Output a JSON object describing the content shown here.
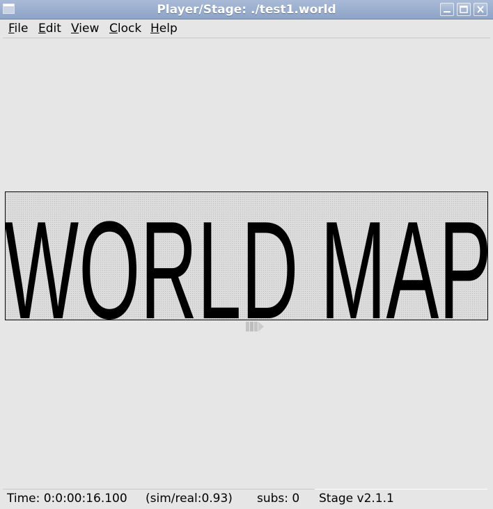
{
  "window": {
    "title": "Player/Stage: ./test1.world"
  },
  "menu": {
    "items": [
      {
        "mnemonic": "F",
        "rest": "ile"
      },
      {
        "mnemonic": "E",
        "rest": "dit"
      },
      {
        "mnemonic": "V",
        "rest": "iew"
      },
      {
        "mnemonic": "C",
        "rest": "lock"
      },
      {
        "mnemonic": "H",
        "rest": "elp"
      }
    ]
  },
  "map": {
    "text": "WORLD MAP",
    "background": "#dcdcdc",
    "ink": "#000000"
  },
  "status": {
    "time": "Time: 0:0:00:16.100",
    "ratio": "(sim/real:0.93)",
    "subs": "subs: 0",
    "version": "Stage v2.1.1"
  },
  "colors": {
    "titlebar": "#8ea4c8",
    "background": "#e6e6e6"
  }
}
